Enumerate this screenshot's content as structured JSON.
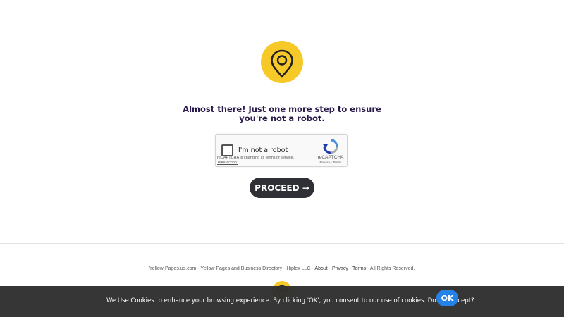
{
  "main": {
    "heading": "Almost there! Just one more step to ensure you're not a robot.",
    "proceed_label": "PROCEED →"
  },
  "recaptcha": {
    "checkbox_label": "I'm not a robot",
    "notice": "reCAPTCHA is changing its terms of service.",
    "action_link": "Take action.",
    "brand": "reCAPTCHA",
    "links": "Privacy - Terms"
  },
  "footer": {
    "site": "Yellow-Pages.us.com - Yellow Pages and Business Directory - Hiplex LLC - ",
    "about": "About",
    "sep1": " - ",
    "privacy": "Privacy",
    "sep2": " - ",
    "terms": "Terms",
    "rights": " - All Rights Reserved."
  },
  "cookie": {
    "message": "We Use Cookies to enhance your browsing experience. By clicking 'OK', you consent to our use of cookies. Do you accept?",
    "ok_label": "OK"
  },
  "colors": {
    "brand_yellow": "#f7c928",
    "heading": "#2a1a4a",
    "button_dark": "#2f3036",
    "cookie_bar": "#303030",
    "ok_blue": "#1e7ee8"
  },
  "icons": {
    "logo": "map-pin-icon",
    "recaptcha": "recaptcha-logo-icon"
  }
}
